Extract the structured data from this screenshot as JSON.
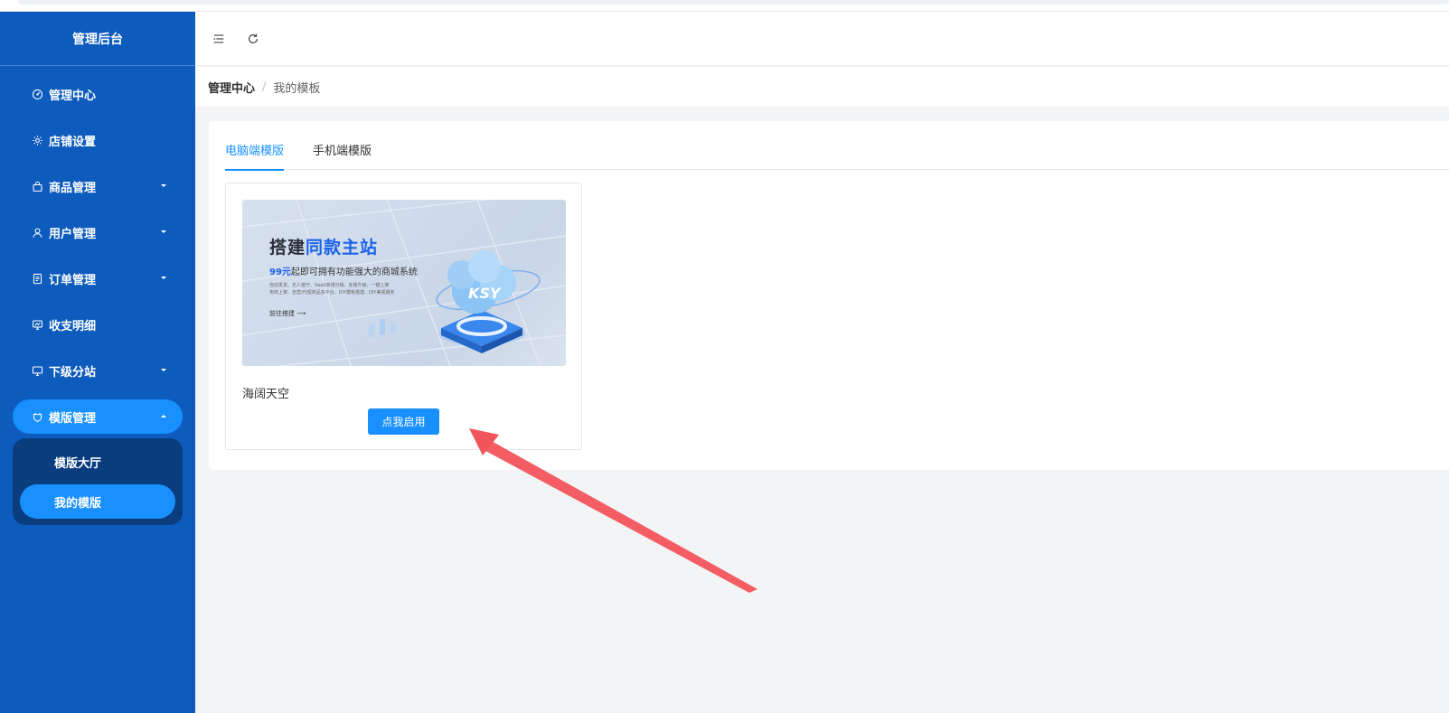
{
  "sidebar": {
    "logo": "管理后台",
    "items": [
      {
        "label": "管理中心",
        "icon": "dashboard-icon"
      },
      {
        "label": "店铺设置",
        "icon": "gear-icon"
      },
      {
        "label": "商品管理",
        "icon": "bag-icon",
        "caret": "down"
      },
      {
        "label": "用户管理",
        "icon": "user-icon",
        "caret": "down"
      },
      {
        "label": "订单管理",
        "icon": "order-icon",
        "caret": "down"
      },
      {
        "label": "收支明细",
        "icon": "chart-icon"
      },
      {
        "label": "下级分站",
        "icon": "monitor-icon",
        "caret": "down"
      },
      {
        "label": "模版管理",
        "icon": "template-icon",
        "caret": "up",
        "open": true
      }
    ],
    "submenu": [
      {
        "label": "模版大厅"
      },
      {
        "label": "我的模版",
        "active": true
      }
    ]
  },
  "header": {
    "menu_toggle_icon": "menu-fold-icon",
    "refresh_icon": "refresh-icon"
  },
  "breadcrumb": {
    "root": "管理中心",
    "separator": "/",
    "current": "我的模板"
  },
  "tabs": [
    {
      "label": "电脑端模版",
      "active": true
    },
    {
      "label": "手机端模版"
    }
  ],
  "template": {
    "thumbnail": {
      "title_black": "搭建",
      "title_blue": "同款主站",
      "subtitle_blue": "99元",
      "subtitle_rest": "起即可拥有功能强大的商城系统",
      "desc_line1": "自动发货、无人值守、SaaS商城分销、安装升级、一键上架",
      "desc_line2": "电商上架、自营/代理商品多平台、DIY模板搭建、DIY美观服务",
      "link": "前往搭建 ⟶",
      "logo_text": "KSY"
    },
    "name": "海阔天空",
    "button": "点我启用"
  },
  "colors": {
    "sidebar_bg": "#0d5bbd",
    "accent": "#1890ff",
    "submenu_bg": "#0a3d7e",
    "annotation_arrow": "#f2545b"
  }
}
